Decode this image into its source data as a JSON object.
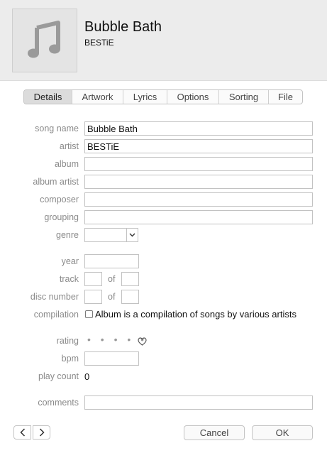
{
  "header": {
    "title": "Bubble Bath",
    "artist": "BESTiE",
    "artwork_icon": "music-note-icon"
  },
  "tabs": [
    "Details",
    "Artwork",
    "Lyrics",
    "Options",
    "Sorting",
    "File"
  ],
  "active_tab": "Details",
  "labels": {
    "song_name": "song name",
    "artist": "artist",
    "album": "album",
    "album_artist": "album artist",
    "composer": "composer",
    "grouping": "grouping",
    "genre": "genre",
    "year": "year",
    "track": "track",
    "disc_number": "disc number",
    "compilation": "compilation",
    "rating": "rating",
    "bpm": "bpm",
    "play_count": "play count",
    "comments": "comments",
    "of": "of"
  },
  "values": {
    "song_name": "Bubble Bath",
    "artist": "BESTiE",
    "album": "",
    "album_artist": "",
    "composer": "",
    "grouping": "",
    "genre": "",
    "year": "",
    "track": "",
    "track_of": "",
    "disc": "",
    "disc_of": "",
    "bpm": "",
    "play_count": "0",
    "comments": "",
    "rating_dots": "• • • • •"
  },
  "compilation_text": "Album is a compilation of songs by various artists",
  "compilation_checked": false,
  "buttons": {
    "cancel": "Cancel",
    "ok": "OK"
  }
}
